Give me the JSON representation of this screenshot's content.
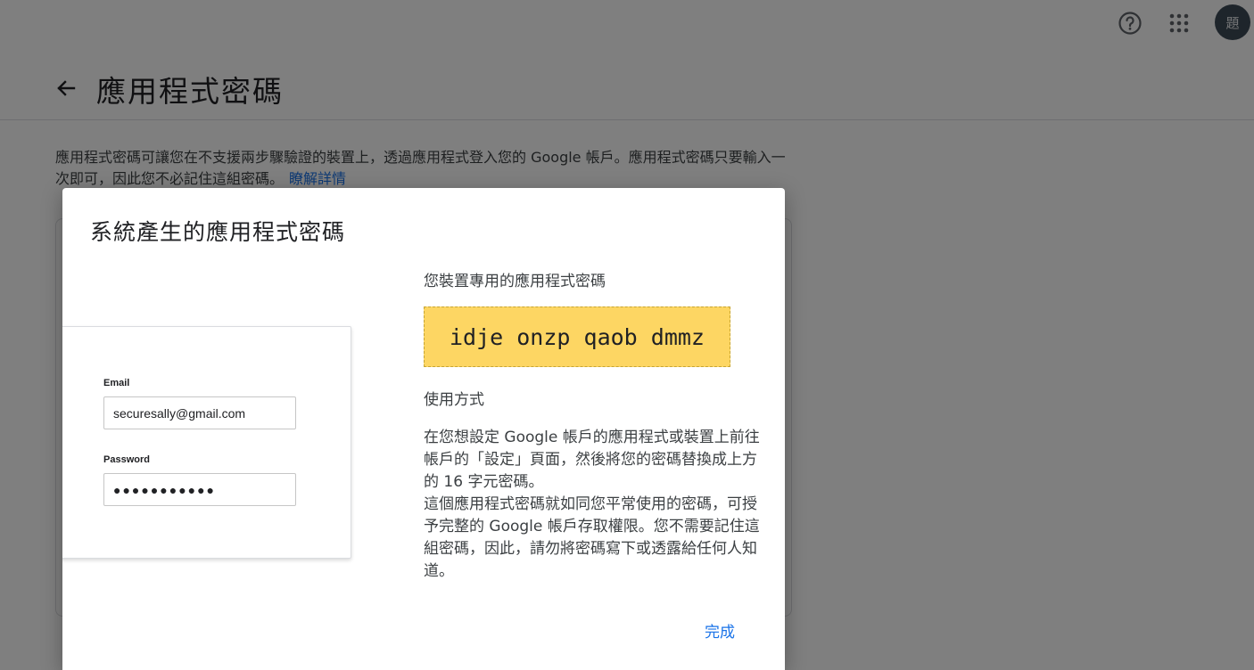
{
  "header": {
    "avatar_text": "題",
    "page_title": "應用程式密碼"
  },
  "description": {
    "text": "應用程式密碼可讓您在不支援兩步驟驗證的裝置上，透過應用程式登入您的 Google 帳戶。應用程式密碼只要輸入一次即可，因此您不必記住這組密碼。",
    "link_text": "瞭解詳情"
  },
  "dialog": {
    "title": "系統產生的應用程式密碼",
    "illustration": {
      "email_label": "Email",
      "email_value": "securesally@gmail.com",
      "password_label": "Password",
      "password_value": "●●●●●●●●●●●"
    },
    "device_password_heading": "您裝置專用的應用程式密碼",
    "generated_password": "idje onzp qaob dmmz",
    "usage_heading": "使用方式",
    "usage_paragraph_1": "在您想設定 Google 帳戶的應用程式或裝置上前往帳戶的「設定」頁面，然後將您的密碼替換成上方的 16 字元密碼。",
    "usage_paragraph_2": "這個應用程式密碼就如同您平常使用的密碼，可授予完整的 Google 帳戶存取權限。您不需要記住這組密碼，因此，請勿將密碼寫下或透露給任何人知道。",
    "done_label": "完成"
  },
  "colors": {
    "accent": "#1a73e8",
    "password_highlight": "#fdd663",
    "scrim": "rgba(0,0,0,0.5)"
  },
  "icons": {
    "help": "help-circle-icon",
    "apps": "apps-grid-icon",
    "back": "arrow-back-icon"
  }
}
